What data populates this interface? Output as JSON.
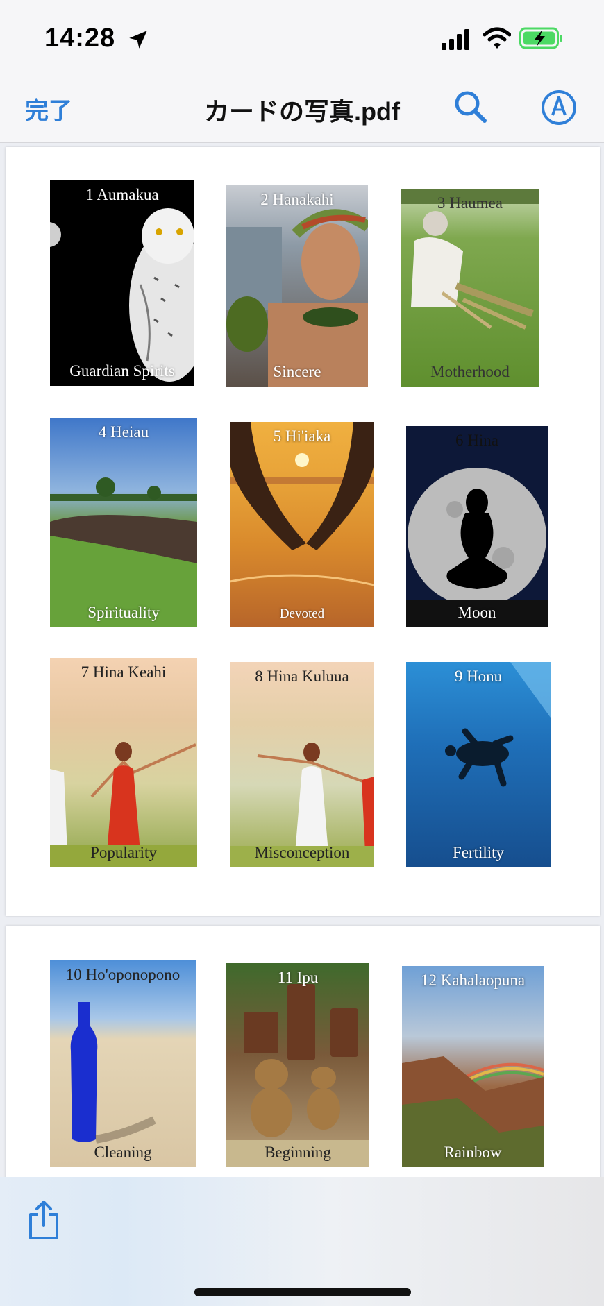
{
  "status_bar": {
    "time": "14:28"
  },
  "nav": {
    "done_label": "完了",
    "title": "カードの写真.pdf"
  },
  "pages": [
    {
      "cards": [
        {
          "title": "1 Aumakua",
          "caption": "Guardian Spirits"
        },
        {
          "title": "2 Hanakahi",
          "caption": "Sincere"
        },
        {
          "title": "3 Haumea",
          "caption": "Motherhood"
        },
        {
          "title": "4 Heiau",
          "caption": "Spirituality"
        },
        {
          "title": "5 Hi'iaka",
          "caption": "Devoted"
        },
        {
          "title": "6 Hina",
          "caption": "Moon"
        },
        {
          "title": "7 Hina Keahi",
          "caption": "Popularity"
        },
        {
          "title": "8 Hina Kuluua",
          "caption": "Misconception"
        },
        {
          "title": "9 Honu",
          "caption": "Fertility"
        }
      ]
    },
    {
      "cards": [
        {
          "title": "10 Ho'oponopono",
          "caption": "Cleaning"
        },
        {
          "title": "11 Ipu",
          "caption": "Beginning"
        },
        {
          "title": "12 Kahalaopuna",
          "caption": "Rainbow"
        }
      ]
    }
  ],
  "colors": {
    "accent": "#2f7fd8",
    "battery": "#4cd964"
  },
  "icons": [
    "location-arrow-icon",
    "signal-icon",
    "wifi-icon",
    "battery-charging-icon",
    "search-icon",
    "markup-pen-icon",
    "share-icon"
  ]
}
